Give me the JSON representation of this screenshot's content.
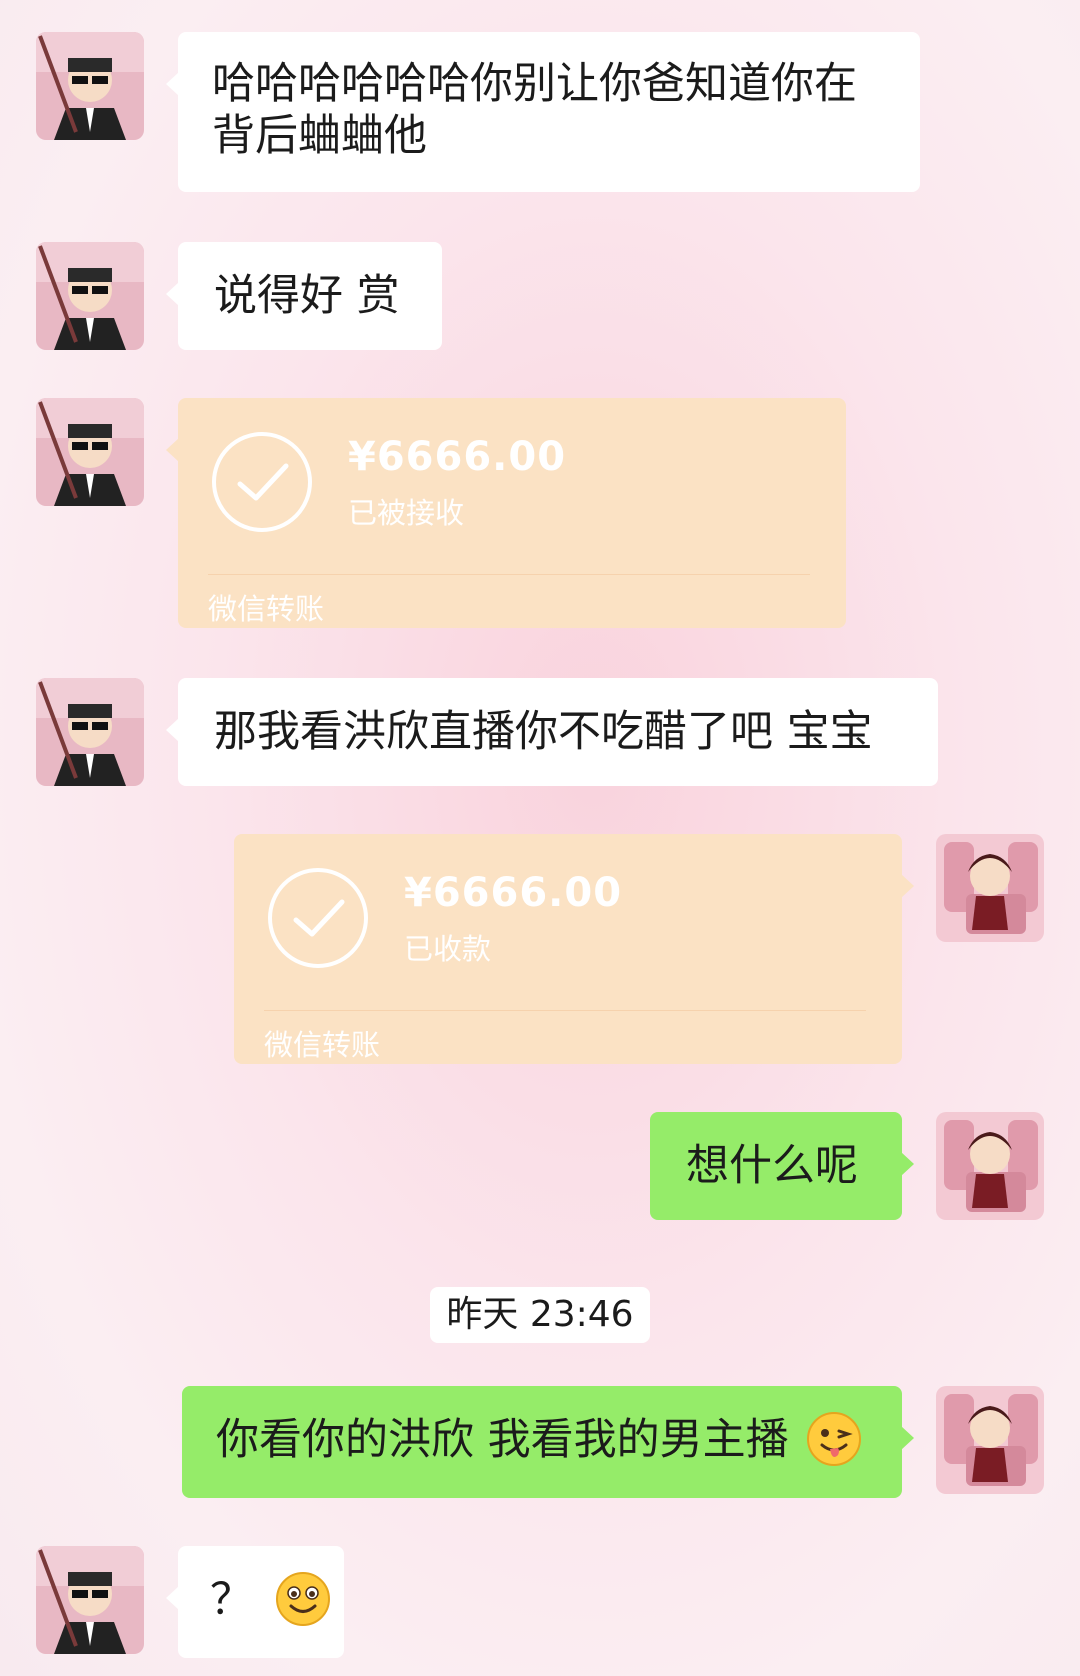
{
  "messages": [
    {
      "type": "text",
      "side": "left",
      "lines": [
        "哈哈哈哈哈哈你别让你爸知道你在",
        "背后蛐蛐他"
      ]
    },
    {
      "type": "text",
      "side": "left",
      "text": "说得好 赏"
    },
    {
      "type": "transfer",
      "side": "left",
      "amount": "¥6666.00",
      "status": "已被接收",
      "source": "微信转账"
    },
    {
      "type": "text",
      "side": "left",
      "text": "那我看洪欣直播你不吃醋了吧 宝宝"
    },
    {
      "type": "transfer",
      "side": "right",
      "amount": "¥6666.00",
      "status": "已收款",
      "source": "微信转账"
    },
    {
      "type": "text",
      "side": "right",
      "text": "想什么呢"
    },
    {
      "type": "timestamp",
      "text": "昨天 23:46"
    },
    {
      "type": "text",
      "side": "right",
      "text": "你看你的洪欣 我看我的男主播",
      "emoji": "wink-tongue-emoji"
    },
    {
      "type": "text",
      "side": "left",
      "text": "？",
      "emoji": "smile-emoji"
    }
  ],
  "colors": {
    "bubble_left": "#ffffff",
    "bubble_right": "#95ec69",
    "transfer": "#fbe2c4"
  }
}
